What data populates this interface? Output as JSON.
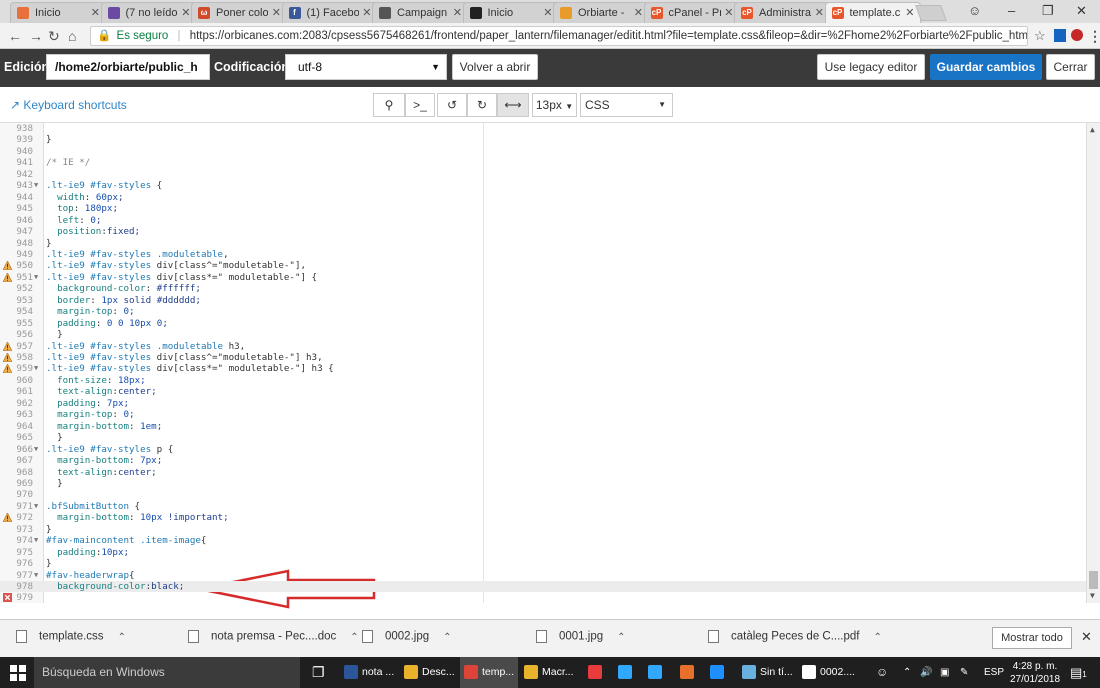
{
  "browser": {
    "tabs": [
      {
        "title": "Inicio",
        "color": "#e8703a",
        "glyph": ""
      },
      {
        "title": "(7 no leído",
        "color": "#6a4aa3",
        "glyph": ""
      },
      {
        "title": "Poner colo",
        "color": "#d24a2c",
        "glyph": "ω"
      },
      {
        "title": "(1) Facebo",
        "color": "#3b5998",
        "glyph": "f"
      },
      {
        "title": "Campaign",
        "color": "#555555",
        "glyph": ""
      },
      {
        "title": "Inicio",
        "color": "#222222",
        "glyph": ""
      },
      {
        "title": "Orbiarte -",
        "color": "#e89b2b",
        "glyph": ""
      },
      {
        "title": "cPanel - Pr",
        "color": "#e8562b",
        "glyph": "cP"
      },
      {
        "title": "Administra",
        "color": "#e8562b",
        "glyph": "cP"
      },
      {
        "title": "template.c",
        "color": "#e8562b",
        "glyph": "cP"
      }
    ],
    "secure_label": "Es seguro",
    "url": "https://orbicanes.com:2083/cpsess5675468261/frontend/paper_lantern/filemanager/editit.html?file=template.css&fileop=&dir=%2Fhome2%2Forbiarte%2Fpublic_html%2Fte..."
  },
  "toolbar": {
    "edit_label": "Edición:",
    "path_value": "/home2/orbiarte/public_h",
    "encoding_label": "Codificación:",
    "encoding_value": "utf-8",
    "reopen_label": "Volver a abrir",
    "legacy_label": "Use legacy editor",
    "save_label": "Guardar cambios",
    "close_label": "Cerrar"
  },
  "subbar": {
    "shortcuts_label": "Keyboard shortcuts",
    "font_size": "13px",
    "mode": "CSS",
    "terminal_glyph": ">_"
  },
  "editor": {
    "lines": [
      {
        "n": "938",
        "code": "",
        "fold": false,
        "warn": false,
        "err": false
      },
      {
        "n": "939",
        "code": "}",
        "fold": false,
        "warn": false,
        "err": false
      },
      {
        "n": "940",
        "code": "",
        "fold": false,
        "warn": false,
        "err": false
      },
      {
        "n": "941",
        "code": "/* IE */",
        "fold": false,
        "warn": false,
        "err": false
      },
      {
        "n": "942",
        "code": "",
        "fold": false,
        "warn": false,
        "err": false
      },
      {
        "n": "943",
        "code": ".lt-ie9 #fav-styles {",
        "fold": true,
        "warn": false,
        "err": false
      },
      {
        "n": "944",
        "code": "  width: 60px;",
        "fold": false,
        "warn": false,
        "err": false
      },
      {
        "n": "945",
        "code": "  top: 180px;",
        "fold": false,
        "warn": false,
        "err": false
      },
      {
        "n": "946",
        "code": "  left: 0;",
        "fold": false,
        "warn": false,
        "err": false
      },
      {
        "n": "947",
        "code": "  position:fixed;",
        "fold": false,
        "warn": false,
        "err": false
      },
      {
        "n": "948",
        "code": "}",
        "fold": false,
        "warn": false,
        "err": false
      },
      {
        "n": "949",
        "code": ".lt-ie9 #fav-styles .moduletable,",
        "fold": false,
        "warn": false,
        "err": false
      },
      {
        "n": "950",
        "code": ".lt-ie9 #fav-styles div[class^=\"moduletable-\"],",
        "fold": false,
        "warn": true,
        "err": false
      },
      {
        "n": "951",
        "code": ".lt-ie9 #fav-styles div[class*=\" moduletable-\"] {",
        "fold": true,
        "warn": true,
        "err": false
      },
      {
        "n": "952",
        "code": "  background-color: #ffffff;",
        "fold": false,
        "warn": false,
        "err": false
      },
      {
        "n": "953",
        "code": "  border: 1px solid #dddddd;",
        "fold": false,
        "warn": false,
        "err": false
      },
      {
        "n": "954",
        "code": "  margin-top: 0;",
        "fold": false,
        "warn": false,
        "err": false
      },
      {
        "n": "955",
        "code": "  padding: 0 0 10px 0;",
        "fold": false,
        "warn": false,
        "err": false
      },
      {
        "n": "956",
        "code": "  }",
        "fold": false,
        "warn": false,
        "err": false
      },
      {
        "n": "957",
        "code": ".lt-ie9 #fav-styles .moduletable h3,",
        "fold": false,
        "warn": true,
        "err": false
      },
      {
        "n": "958",
        "code": ".lt-ie9 #fav-styles div[class^=\"moduletable-\"] h3,",
        "fold": false,
        "warn": true,
        "err": false
      },
      {
        "n": "959",
        "code": ".lt-ie9 #fav-styles div[class*=\" moduletable-\"] h3 {",
        "fold": true,
        "warn": true,
        "err": false
      },
      {
        "n": "960",
        "code": "  font-size: 18px;",
        "fold": false,
        "warn": false,
        "err": false
      },
      {
        "n": "961",
        "code": "  text-align:center;",
        "fold": false,
        "warn": false,
        "err": false
      },
      {
        "n": "962",
        "code": "  padding: 7px;",
        "fold": false,
        "warn": false,
        "err": false
      },
      {
        "n": "963",
        "code": "  margin-top: 0;",
        "fold": false,
        "warn": false,
        "err": false
      },
      {
        "n": "964",
        "code": "  margin-bottom: 1em;",
        "fold": false,
        "warn": false,
        "err": false
      },
      {
        "n": "965",
        "code": "  }",
        "fold": false,
        "warn": false,
        "err": false
      },
      {
        "n": "966",
        "code": ".lt-ie9 #fav-styles p {",
        "fold": true,
        "warn": false,
        "err": false
      },
      {
        "n": "967",
        "code": "  margin-bottom: 7px;",
        "fold": false,
        "warn": false,
        "err": false
      },
      {
        "n": "968",
        "code": "  text-align:center;",
        "fold": false,
        "warn": false,
        "err": false
      },
      {
        "n": "969",
        "code": "  }",
        "fold": false,
        "warn": false,
        "err": false
      },
      {
        "n": "970",
        "code": "",
        "fold": false,
        "warn": false,
        "err": false
      },
      {
        "n": "971",
        "code": ".bfSubmitButton {",
        "fold": true,
        "warn": false,
        "err": false
      },
      {
        "n": "972",
        "code": "  margin-bottom: 10px !important;",
        "fold": false,
        "warn": true,
        "err": false
      },
      {
        "n": "973",
        "code": "}",
        "fold": false,
        "warn": false,
        "err": false
      },
      {
        "n": "974",
        "code": "#fav-maincontent .item-image{",
        "fold": true,
        "warn": false,
        "err": false
      },
      {
        "n": "975",
        "code": "  padding:10px;",
        "fold": false,
        "warn": false,
        "err": false
      },
      {
        "n": "976",
        "code": "}",
        "fold": false,
        "warn": false,
        "err": false
      },
      {
        "n": "977",
        "code": "#fav-headerwrap{",
        "fold": true,
        "warn": false,
        "err": false
      },
      {
        "n": "978",
        "code": "  background-color:black;",
        "fold": false,
        "warn": false,
        "err": false,
        "highlight": true
      },
      {
        "n": "979",
        "code": "",
        "fold": false,
        "warn": false,
        "err": true
      }
    ]
  },
  "downloads": {
    "items": [
      "template.css",
      "nota premsa - Pec....doc",
      "0002.jpg",
      "0001.jpg",
      "catàleg Peces de C....pdf"
    ],
    "show_all": "Mostrar todo"
  },
  "taskbar": {
    "search_placeholder": "Búsqueda en Windows",
    "apps": [
      {
        "label": "nota ...",
        "color": "#2b579a"
      },
      {
        "label": "Desc...",
        "color": "#e8b32b"
      },
      {
        "label": "temp...",
        "color": "#db4437"
      },
      {
        "label": "Macr...",
        "color": "#e8b32b"
      },
      {
        "label": "",
        "color": "#e83b3b"
      },
      {
        "label": "",
        "color": "#31a8ff"
      },
      {
        "label": "",
        "color": "#31a8ff"
      },
      {
        "label": "",
        "color": "#e8702b"
      },
      {
        "label": "",
        "color": "#1e90ff"
      },
      {
        "label": "Sin tí...",
        "color": "#6ab0de"
      },
      {
        "label": "0002....",
        "color": "#ffffff"
      }
    ],
    "language": "ESP",
    "time": "4:28 p. m.",
    "date": "27/01/2018",
    "notif_count": "1"
  },
  "colors": {
    "accent": "#1a74c5",
    "error": "#d9534f",
    "warning": "#f0ad4e",
    "annotation_arrow": "#d62b2b"
  }
}
